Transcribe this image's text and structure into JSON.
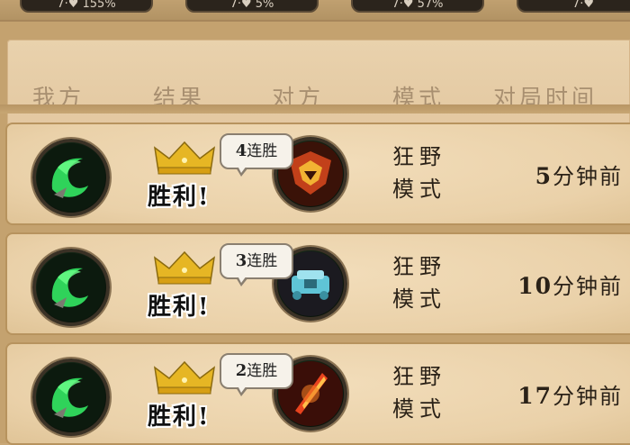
{
  "top_stats": [
    "7·♥ 155%",
    "7·♥ 5%",
    "7·♥ 57%",
    "7·♥"
  ],
  "columns": {
    "mine": "我方",
    "result": "结果",
    "opponent": "对方",
    "mode": "模式",
    "time": "对局时间"
  },
  "matches": [
    {
      "result": "胜利!",
      "streak_num": "4",
      "streak_label": "连胜",
      "mode_line1": "狂野",
      "mode_line2": "模式",
      "time_num": "5",
      "time_unit": "分钟前",
      "opponent_icon": "fire-sigil-icon"
    },
    {
      "result": "胜利!",
      "streak_num": "3",
      "streak_label": "连胜",
      "mode_line1": "狂野",
      "mode_line2": "模式",
      "time_num": "10",
      "time_unit": "分钟前",
      "opponent_icon": "ice-mech-icon"
    },
    {
      "result": "胜利!",
      "streak_num": "2",
      "streak_label": "连胜",
      "mode_line1": "狂野",
      "mode_line2": "模式",
      "time_num": "17",
      "time_unit": "分钟前",
      "opponent_icon": "fire-blade-icon"
    }
  ],
  "colors": {
    "background": "#c9a877",
    "row_fill": "#ead1a9",
    "header_text": "#a88f70",
    "crown_gold": "#e6b624",
    "hero_green": "#2fd35a"
  }
}
